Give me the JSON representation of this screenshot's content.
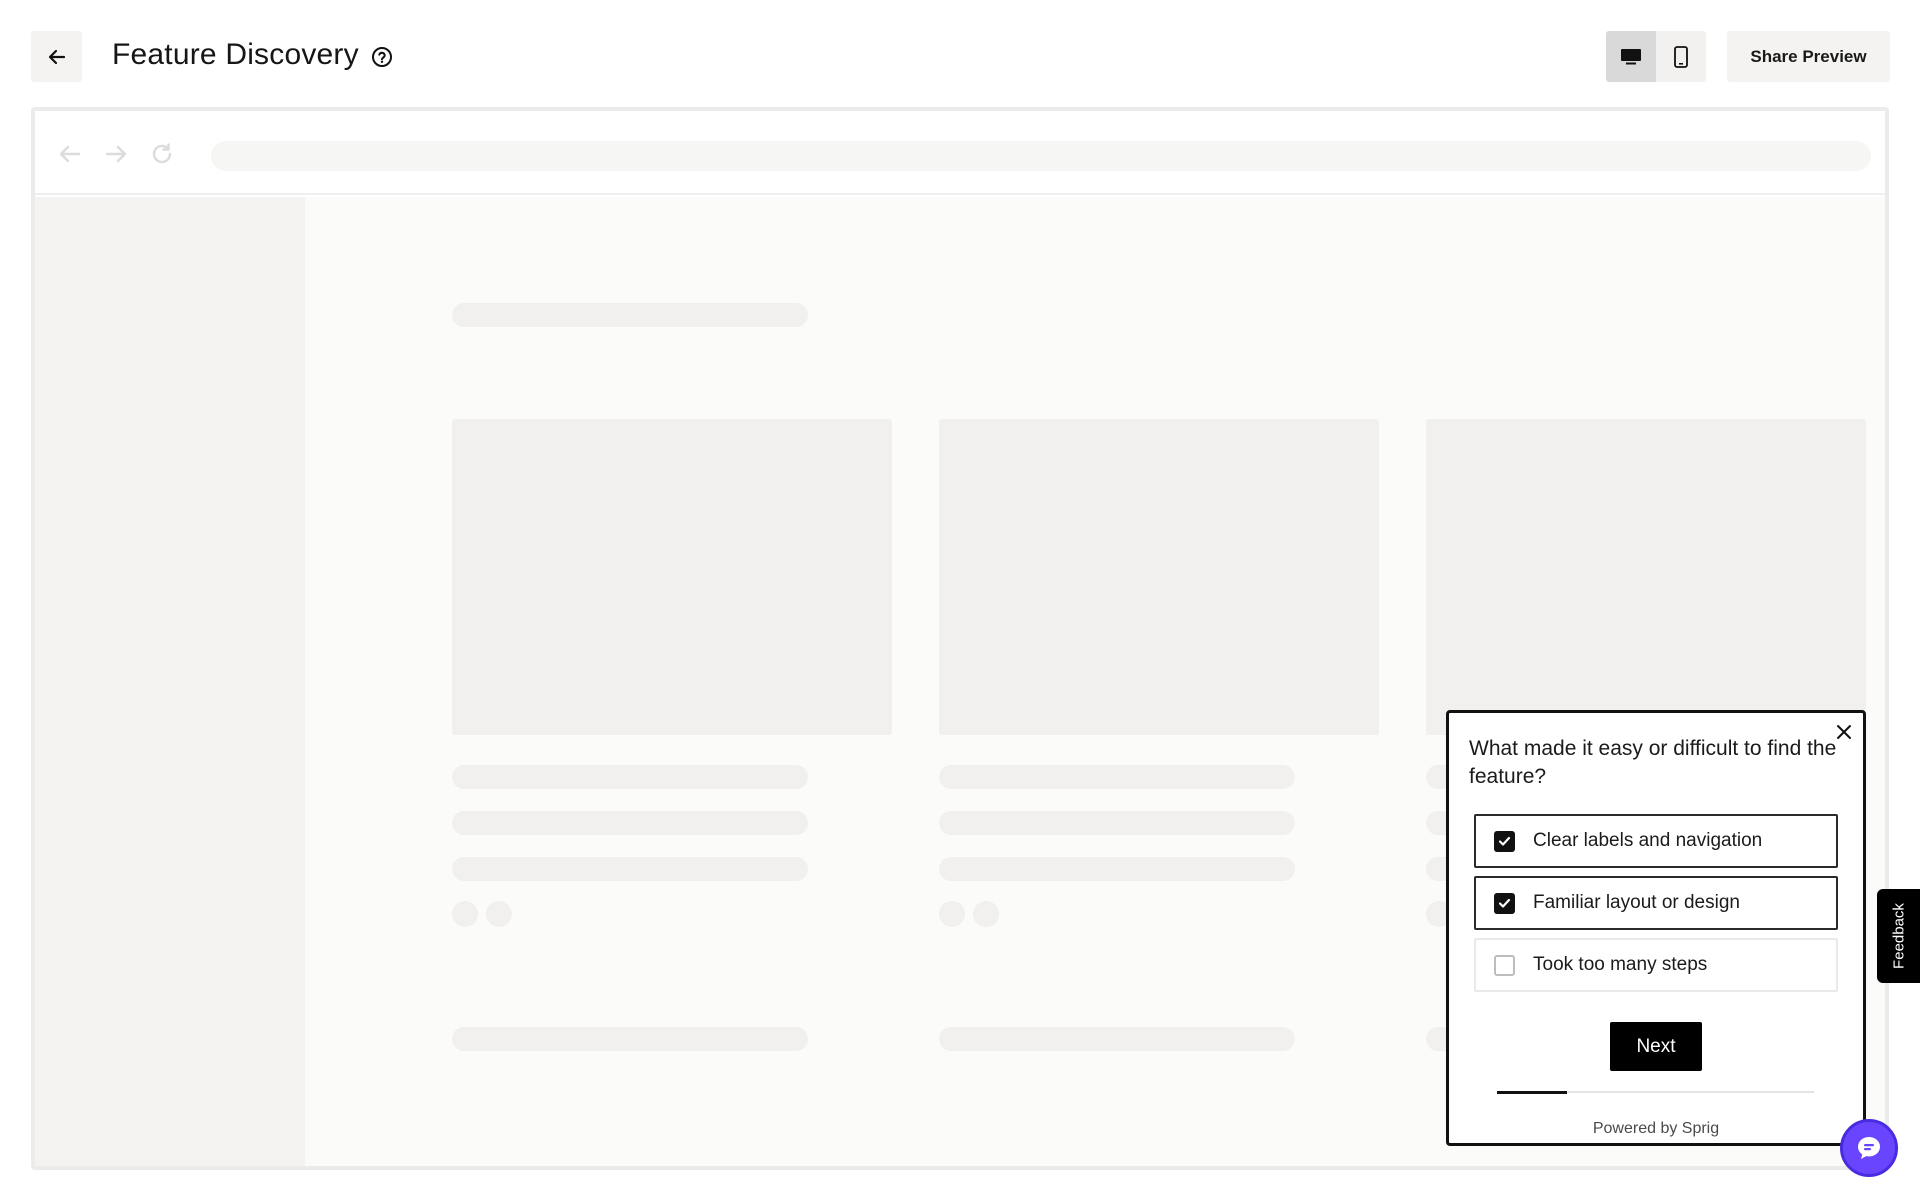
{
  "header": {
    "back_icon": "arrow-left-icon",
    "title": "Feature Discovery",
    "help_icon": "question-circle-icon",
    "device_toggle": {
      "active": "desktop",
      "options": [
        "desktop-icon",
        "mobile-icon"
      ]
    },
    "share_label": "Share Preview"
  },
  "browser": {
    "nav_icons": [
      "back-arrow-icon",
      "forward-arrow-icon",
      "reload-icon"
    ]
  },
  "survey": {
    "question": "What made it easy or difficult to find the feature?",
    "options": [
      {
        "label": "Clear labels and navigation",
        "checked": true
      },
      {
        "label": "Familiar layout or design",
        "checked": true
      },
      {
        "label": "Took too many steps",
        "checked": false
      }
    ],
    "next_label": "Next",
    "progress": 0.22,
    "powered_by": "Powered by Sprig"
  },
  "feedback_tab": {
    "label": "Feedback"
  },
  "chat": {
    "icon": "chat-icon",
    "color": "#6a45ff"
  }
}
